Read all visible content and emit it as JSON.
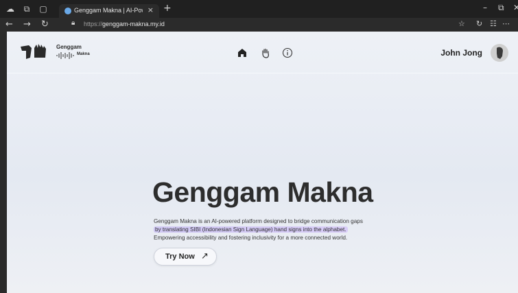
{
  "browser": {
    "tab_title": "Genggam Makna | AI-Powered Si",
    "url_scheme": "https://",
    "url_host": "genggam-makna.my.id",
    "tab_close_glyph": "×",
    "new_tab_glyph": "+"
  },
  "header": {
    "logo_title": "Genggam",
    "logo_subtitle": "Makna",
    "user_name": "John Jong"
  },
  "hero": {
    "title": "Genggam Makna",
    "desc_line1": "Genggam Makna is an AI-powered platform designed to bridge communication gaps",
    "desc_line2": "by translating SIBI (Indonesian Sign Language) hand signs into the alphabet.",
    "desc_line3": "Empowering accessibility and fostering inclusivity for a more connected world.",
    "button_label": "Try Now"
  },
  "icons": {
    "nav": [
      "home-icon",
      "hand-icon",
      "info-icon"
    ],
    "button": "arrow-up-right-icon"
  },
  "colors": {
    "highlight": "#d2c8f5",
    "page_bg": "#e8ecf3",
    "title": "#2d2d2d"
  }
}
